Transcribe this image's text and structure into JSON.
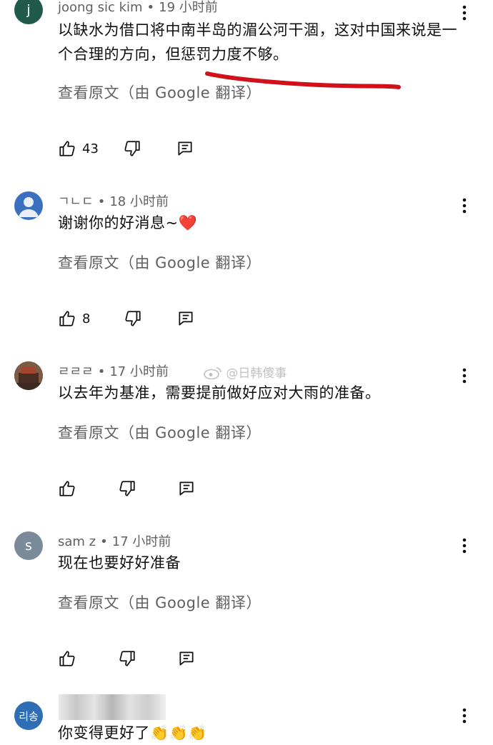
{
  "comments": [
    {
      "author": "joong sic kim",
      "time": "19 小时前",
      "avatar_letter": "j",
      "avatar_color": "#1f5a4a",
      "text": "以缺水为借口将中南半岛的湄公河干涸，这对中国来说是一个合理的方向，但惩罚力度不够。",
      "translate": "查看原文（由 Google 翻译）",
      "likes": "43"
    },
    {
      "author": "ㄱㄴㄷ",
      "time": "18 小时前",
      "avatar_letter": "",
      "avatar_color": "#3b6fbf",
      "text": "谢谢你的好消息~❤️",
      "translate": "查看原文（由 Google 翻译）",
      "likes": "8"
    },
    {
      "author": "ㄹㄹㄹ",
      "time": "17 小时前",
      "avatar_letter": "",
      "avatar_color": "#6b4a3a",
      "text": "以去年为基准，需要提前做好应对大雨的准备。",
      "translate": "查看原文（由 Google 翻译）",
      "likes": ""
    },
    {
      "author": "sam z",
      "time": "17 小时前",
      "avatar_letter": "s",
      "avatar_color": "#7b8a99",
      "text": "现在也要好好准备",
      "translate": "查看原文（由 Google 翻译）",
      "likes": ""
    },
    {
      "author": "",
      "time": "",
      "avatar_letter": "리송",
      "avatar_color": "#2f6db5",
      "text": "你变得更好了👏👏👏",
      "translate": "",
      "likes": ""
    }
  ],
  "watermark": "@日韩傻事",
  "colors": {
    "annotation_red": "#d0101a"
  }
}
